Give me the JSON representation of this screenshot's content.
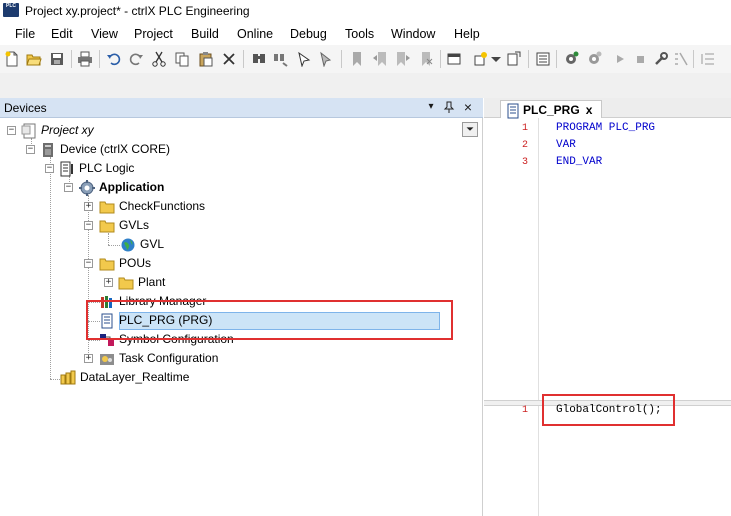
{
  "window": {
    "logo_text": "PLC",
    "title": "Project xy.project* - ctrlX PLC Engineering"
  },
  "menu": [
    "File",
    "Edit",
    "View",
    "Project",
    "Build",
    "Online",
    "Debug",
    "Tools",
    "Window",
    "Help"
  ],
  "devices_panel": {
    "title": "Devices",
    "dropdown_glyph": "▾",
    "pin_glyph": "ᵖ",
    "close_glyph": "×",
    "tree": {
      "project": "Project xy",
      "device": "Device (ctrlX CORE)",
      "plc_logic": "PLC Logic",
      "application": "Application",
      "check_functions": "CheckFunctions",
      "gvls": "GVLs",
      "gvl": "GVL",
      "pous": "POUs",
      "plant": "Plant",
      "library_manager": "Library Manager",
      "plc_prg": "PLC_PRG (PRG)",
      "symbol_configuration": "Symbol Configuration",
      "task_configuration": "Task Configuration",
      "datalayer": "DataLayer_Realtime"
    }
  },
  "editor": {
    "tab_label": "PLC_PRG",
    "tab_close": "x",
    "declaration": [
      {
        "ln": "1",
        "code": "PROGRAM PLC_PRG"
      },
      {
        "ln": "2",
        "code": "VAR"
      },
      {
        "ln": "3",
        "code": "END_VAR"
      }
    ],
    "implementation": [
      {
        "ln": "1",
        "code": "GlobalControl();"
      }
    ]
  },
  "colors": {
    "panel_header": "#d6e3f3",
    "selection": "#cce4f7",
    "highlight_box": "#e03030",
    "keyword": "#0000cc",
    "line_number": "#cc2222"
  }
}
